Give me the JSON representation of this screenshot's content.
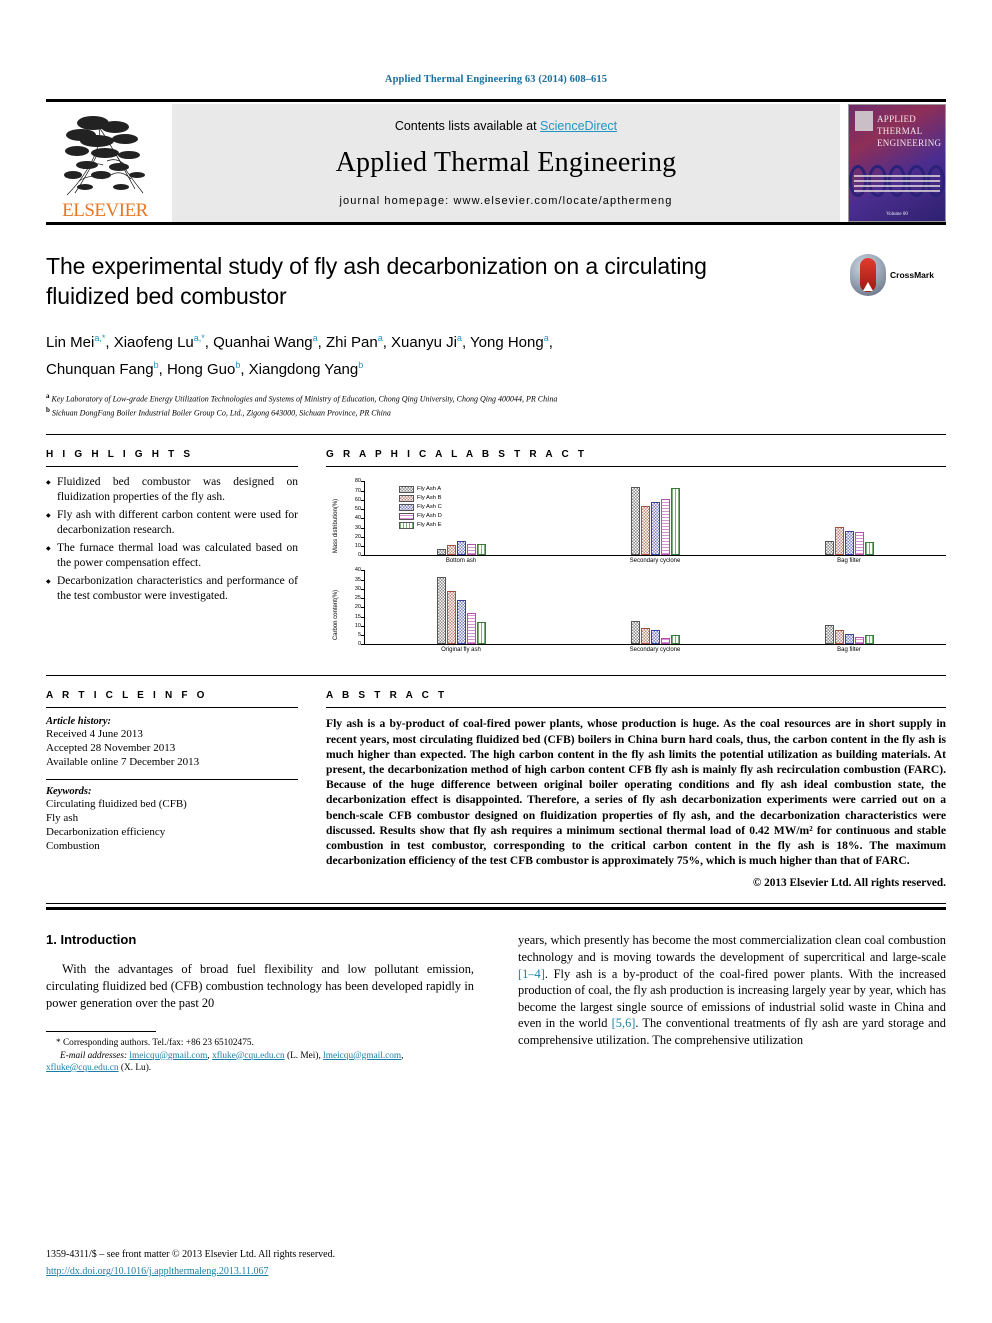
{
  "running_head": "Applied Thermal Engineering 63 (2014) 608–615",
  "masthead": {
    "contents_prefix": "Contents lists available at ",
    "sciencedirect": "ScienceDirect",
    "journal_title": "Applied Thermal Engineering",
    "homepage": "journal homepage: www.elsevier.com/locate/apthermeng",
    "publisher": "ELSEVIER",
    "cover_title_line1": "APPLIED",
    "cover_title_line2": "THERMAL",
    "cover_title_line3": "ENGINEERING",
    "cover_footer": "Volume 00"
  },
  "article": {
    "title": "The experimental study of fly ash decarbonization on a circulating fluidized bed combustor",
    "crossmark_label": "CrossMark",
    "authors_line1": "Lin Mei a,*, Xiaofeng Lu a,*, Quanhai Wang a, Zhi Pan a, Xuanyu Ji a, Yong Hong a,",
    "authors_line2": "Chunquan Fang b, Hong Guo b, Xiangdong Yang b",
    "affiliation_a": "Key Laboratory of Low-grade Energy Utilization Technologies and Systems of Ministry of Education, Chong Qing University, Chong Qing 400044, PR China",
    "affiliation_b": "Sichuan DongFang Boiler Industrial Boiler Group Co, Ltd., Zigong 643000, Sichuan Province, PR China"
  },
  "highlights": {
    "heading": "H I G H L I G H T S",
    "items": [
      "Fluidized bed combustor was designed on fluidization properties of the fly ash.",
      "Fly ash with different carbon content were used for decarbonization research.",
      "The furnace thermal load was calculated based on the power compensation effect.",
      "Decarbonization characteristics and performance of the test combustor were investigated."
    ]
  },
  "graphical_abstract": {
    "heading": "G R A P H I C A L   A B S T R A C T"
  },
  "chart_data": [
    {
      "type": "bar",
      "title": "",
      "ylabel": "Mass distribution(%)",
      "xlabel": "",
      "categories": [
        "Bottom ash",
        "Secondary cyclone",
        "Bag filter"
      ],
      "ylim": [
        0,
        80
      ],
      "yticks": [
        0,
        10,
        20,
        30,
        40,
        50,
        60,
        70,
        80
      ],
      "grid": false,
      "legend_position": "top-left",
      "series": [
        {
          "name": "Fly Ash A",
          "values": [
            7,
            74,
            16
          ]
        },
        {
          "name": "Fly Ash B",
          "values": [
            11,
            53,
            31
          ]
        },
        {
          "name": "Fly Ash C",
          "values": [
            15,
            58,
            26
          ]
        },
        {
          "name": "Fly Ash D",
          "values": [
            12,
            61,
            25
          ]
        },
        {
          "name": "Fly Ash E",
          "values": [
            12,
            73,
            14
          ]
        }
      ]
    },
    {
      "type": "bar",
      "title": "",
      "ylabel": "Carbon content(%)",
      "xlabel": "",
      "categories": [
        "Original fly ash",
        "Secondary cyclone",
        "Bag filter"
      ],
      "ylim": [
        0,
        40
      ],
      "yticks": [
        0,
        5,
        10,
        15,
        20,
        25,
        30,
        35,
        40
      ],
      "grid": false,
      "legend_position": "none",
      "series": [
        {
          "name": "Fly Ash A",
          "values": [
            36.5,
            12.5,
            10.5
          ]
        },
        {
          "name": "Fly Ash B",
          "values": [
            29,
            9,
            7.5
          ]
        },
        {
          "name": "Fly Ash C",
          "values": [
            24,
            7.5,
            5.5
          ]
        },
        {
          "name": "Fly Ash D",
          "values": [
            17,
            3.5,
            4
          ]
        },
        {
          "name": "Fly Ash E",
          "values": [
            12,
            5,
            5
          ]
        }
      ]
    }
  ],
  "article_info": {
    "heading": "A R T I C L E   I N F O",
    "history_label": "Article history:",
    "received": "Received 4 June 2013",
    "accepted": "Accepted 28 November 2013",
    "online": "Available online 7 December 2013",
    "keywords_label": "Keywords:",
    "keywords": [
      "Circulating fluidized bed (CFB)",
      "Fly ash",
      "Decarbonization efficiency",
      "Combustion"
    ]
  },
  "abstract": {
    "heading": "A B S T R A C T",
    "text": "Fly ash is a by-product of coal-fired power plants, whose production is huge. As the coal resources are in short supply in recent years, most circulating fluidized bed (CFB) boilers in China burn hard coals, thus, the carbon content in the fly ash is much higher than expected. The high carbon content in the fly ash limits the potential utilization as building materials. At present, the decarbonization method of high carbon content CFB fly ash is mainly fly ash recirculation combustion (FARC). Because of the huge difference between original boiler operating conditions and fly ash ideal combustion state, the decarbonization effect is disappointed. Therefore, a series of fly ash decarbonization experiments were carried out on a bench-scale CFB combustor designed on fluidization properties of fly ash, and the decarbonization characteristics were discussed. Results show that fly ash requires a minimum sectional thermal load of 0.42 MW/m² for continuous and stable combustion in test combustor, corresponding to the critical carbon content in the fly ash is 18%. The maximum decarbonization efficiency of the test CFB combustor is approximately 75%, which is much higher than that of FARC.",
    "copyright": "© 2013 Elsevier Ltd. All rights reserved."
  },
  "introduction": {
    "heading": "1. Introduction",
    "col1_p1": "With the advantages of broad fuel flexibility and low pollutant emission, circulating fluidized bed (CFB) combustion technology has been developed rapidly in power generation over the past 20",
    "col2_part1": "years, which presently has become the most commercialization clean coal combustion technology and is moving towards the development of supercritical and large-scale ",
    "ref_1_4": "[1–4]",
    "col2_part2": ". Fly ash is a by-product of the coal-fired power plants. With the increased production of coal, the fly ash production is increasing largely year by year, which has become the largest single source of emissions of industrial solid waste in China and even in the world ",
    "ref_5_6": "[5,6]",
    "col2_part3": ". The conventional treatments of fly ash are yard storage and comprehensive utilization. The comprehensive utilization"
  },
  "footnote": {
    "corresponding": "* Corresponding authors. Tel./fax: +86 23 65102475.",
    "email_label": "E-mail addresses:",
    "email1": "lmeicqu@gmail.com",
    "email2": "xfluke@cqu.edu.cn",
    "email1_owner": "(L. Mei),",
    "email3": "lmeicqu@gmail.com",
    "email4": "xfluke@cqu.edu.cn",
    "email2_owner": "(X. Lu)."
  },
  "issn": {
    "line": "1359-4311/$ – see front matter © 2013 Elsevier Ltd. All rights reserved.",
    "doi": "http://dx.doi.org/10.1016/j.applthermaleng.2013.11.067"
  },
  "colors": {
    "link": "#1a7fa8",
    "sciencedirect": "#2196c4",
    "elsevier_orange": "#e87722"
  }
}
